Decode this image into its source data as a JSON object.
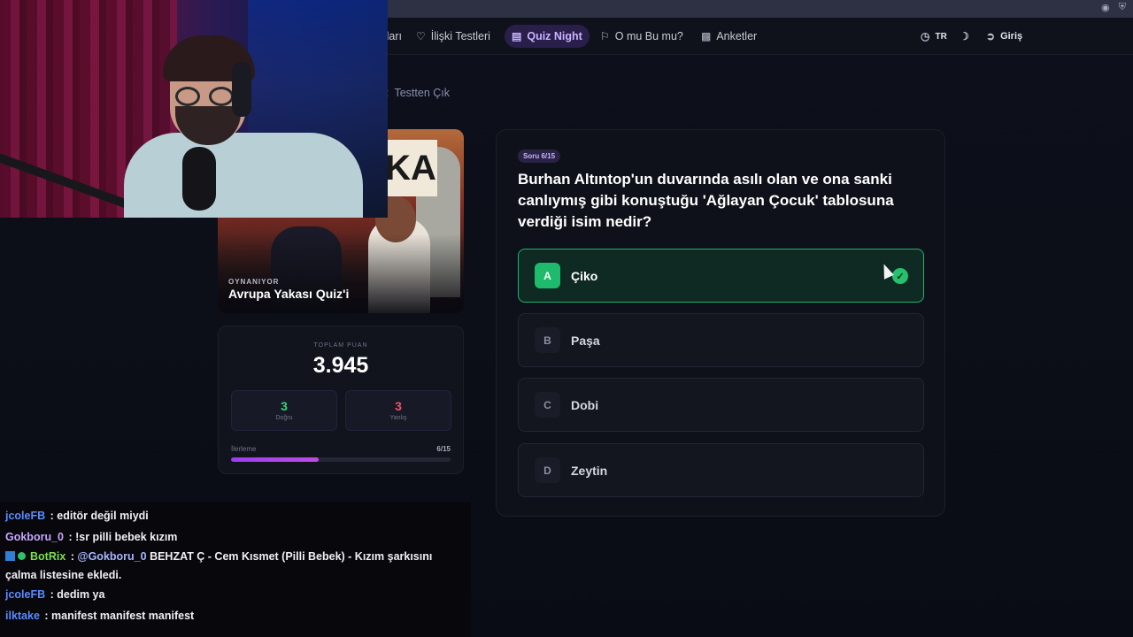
{
  "browser": {
    "icons": [
      "camera-icon",
      "shield-icon"
    ]
  },
  "nav": {
    "partial_item": "ları",
    "items": [
      {
        "label": "İlişki Testleri",
        "icon": "heart-icon"
      },
      {
        "label": "Quiz Night",
        "icon": "quiz-icon",
        "active": true
      },
      {
        "label": "O mu Bu mu?",
        "icon": "trophy-icon"
      },
      {
        "label": "Anketler",
        "icon": "bar-chart-icon"
      }
    ],
    "language": "TR",
    "login": "Giriş"
  },
  "exit_label": "Testten Çık",
  "quiz_cover": {
    "status": "OYNANIYOR",
    "title": "Avrupa Yakası Quiz'i"
  },
  "stats": {
    "label": "TOPLAM PUAN",
    "score": "3.945",
    "correct": {
      "value": "3",
      "label": "Doğru",
      "color": "#34d27a"
    },
    "wrong": {
      "value": "3",
      "label": "Yanlış",
      "color": "#f0506a"
    },
    "progress_label": "İlerleme",
    "progress_text": "6/15",
    "progress_fraction": 0.4
  },
  "question": {
    "badge": "Soru 6/15",
    "text": "Burhan Altıntop'un duvarında asılı olan ve ona sanki canlıymış gibi konuştuğu 'Ağlayan Çocuk' tablosuna verdiği isim nedir?",
    "options": [
      {
        "key": "A",
        "label": "Çiko",
        "state": "correct"
      },
      {
        "key": "B",
        "label": "Paşa"
      },
      {
        "key": "C",
        "label": "Dobi"
      },
      {
        "key": "D",
        "label": "Zeytin"
      }
    ]
  },
  "chat": [
    {
      "user": "jcoleFB",
      "color": "#5a8cff",
      "message": "editör değil miydi"
    },
    {
      "user": "Gokboru_0",
      "color": "#c9a6ff",
      "message": "!sr pilli bebek kızım"
    },
    {
      "user": "BotRix",
      "color": "#7be04e",
      "mention": "@Gokboru_0",
      "message": "BEHZAT Ç - Cem Kısmet (Pilli Bebek) - Kızım şarkısını",
      "message_cont": "çalma listesine ekledi."
    },
    {
      "user": "jcoleFB",
      "color": "#5a8cff",
      "message": "dedim ya"
    },
    {
      "user": "ilktake",
      "color": "#5a8cff",
      "message": "manifest manifest manifest"
    }
  ]
}
